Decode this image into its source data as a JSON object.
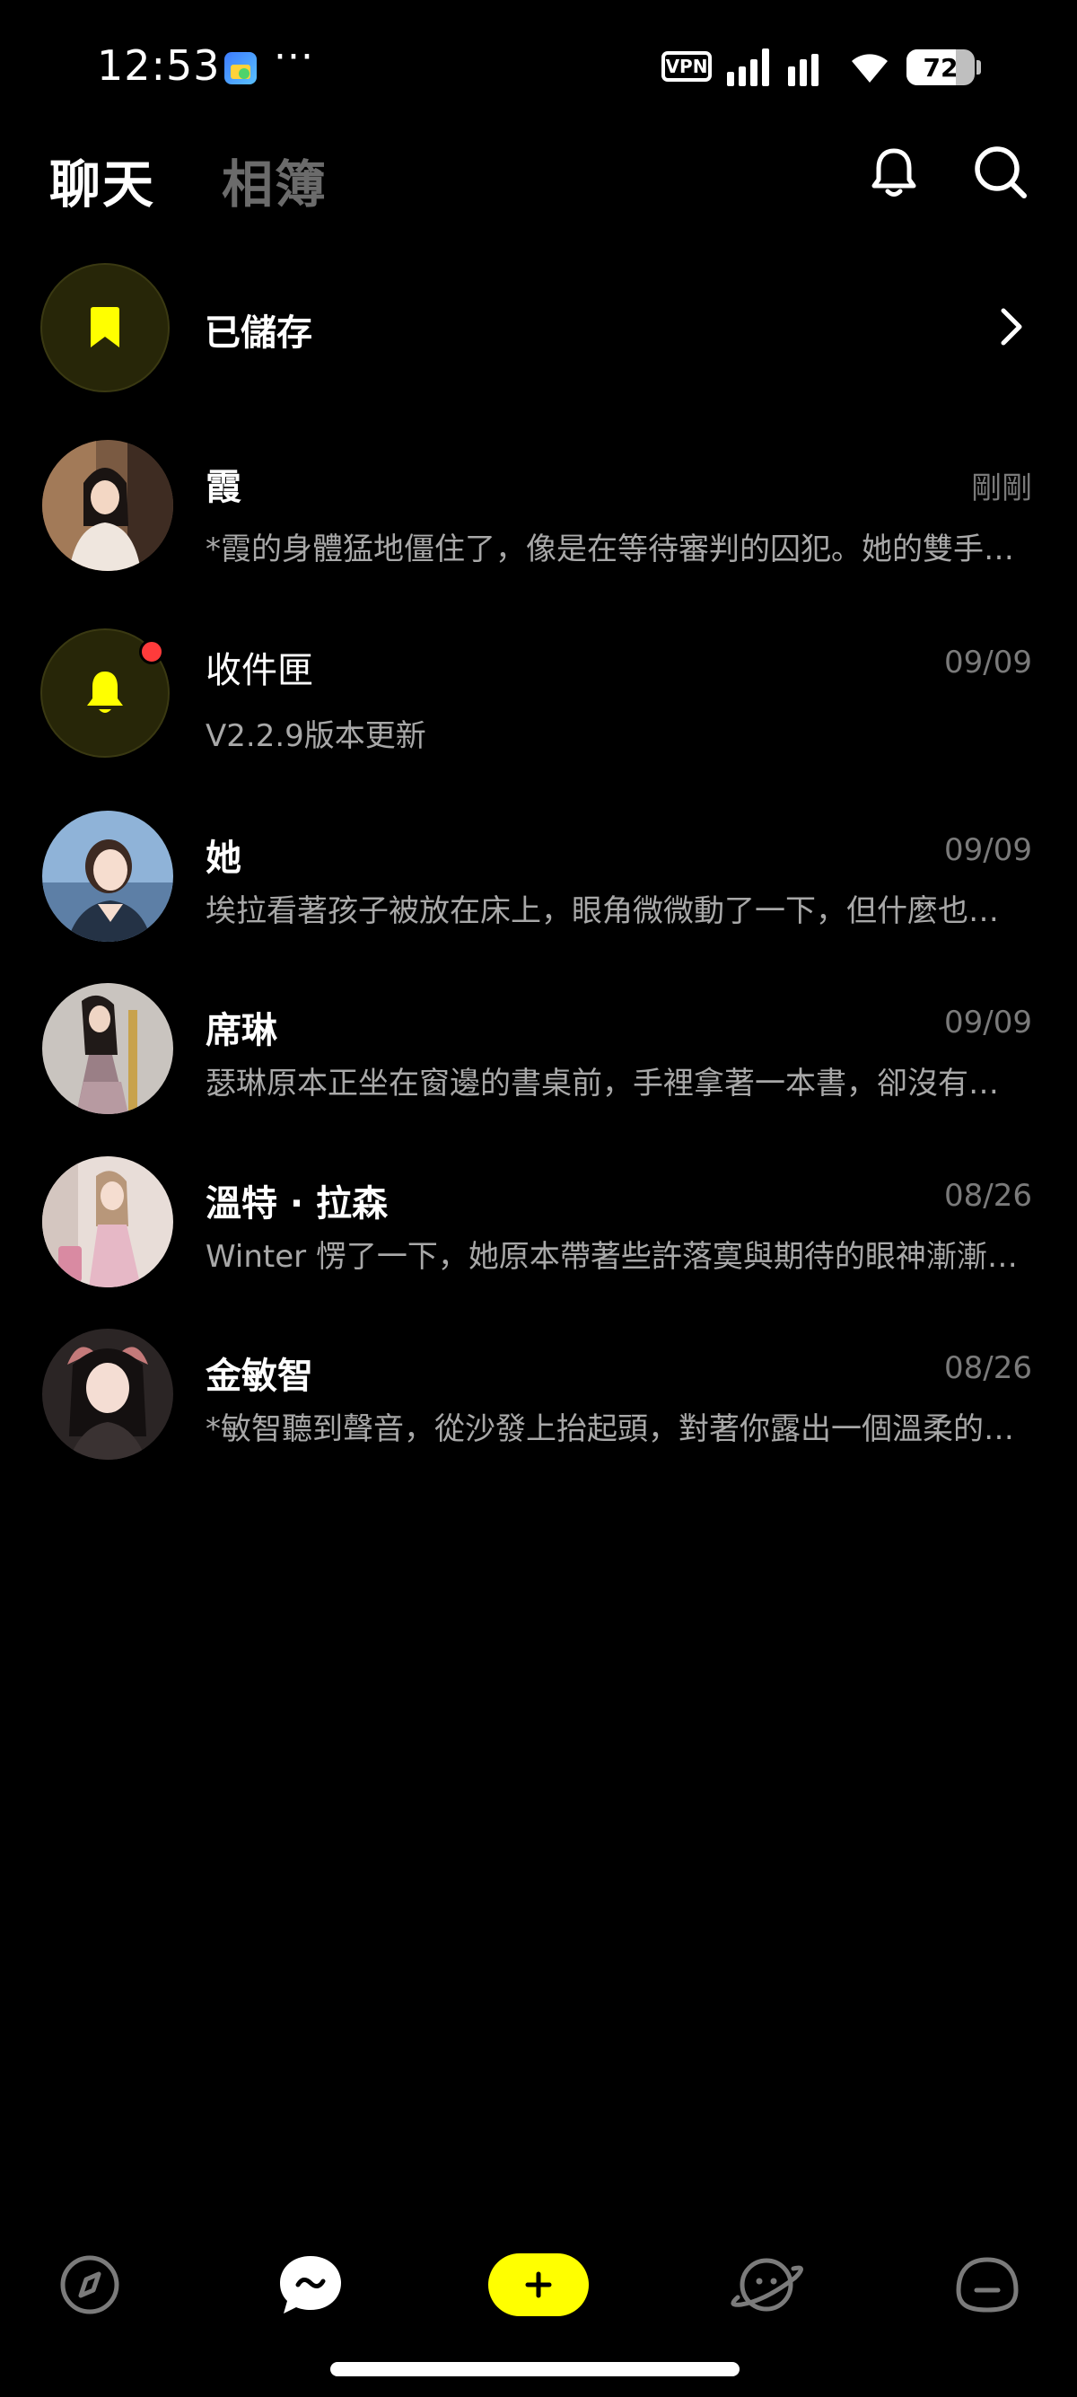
{
  "status_bar": {
    "time": "12:53",
    "more": "···",
    "vpn": "VPN",
    "battery": "72",
    "battery_level": 0.72
  },
  "header": {
    "tabs": [
      {
        "label": "聊天",
        "active": true
      },
      {
        "label": "相簿",
        "active": false
      }
    ],
    "icons": [
      "bell-icon",
      "search-icon"
    ]
  },
  "saved": {
    "label": "已儲存",
    "icon": "bookmark-icon"
  },
  "chats": [
    {
      "name": "霞",
      "time": "剛剛",
      "preview": "*霞的身體猛地僵住了，像是在等待審判的囚犯。她的雙手緊緊抓住衣角"
    },
    {
      "name": "收件匣",
      "time": "09/09",
      "preview": "V2.2.9版本更新",
      "unread": true
    },
    {
      "name": "她",
      "time": "09/09",
      "preview": "埃拉看著孩子被放在床上，眼角微微動了一下，但什麼也沒有說"
    },
    {
      "name": "席琳",
      "time": "09/09",
      "preview": "瑟琳原本正坐在窗邊的書桌前，手裡拿著一本書，卻沒有翻頁"
    },
    {
      "name": "溫特 · 拉森",
      "time": "08/26",
      "preview": "Winter 愣了一下，她原本帶著些許落寞與期待的眼神漸漸亮了起來"
    },
    {
      "name": "金敏智",
      "time": "08/26",
      "preview": "*敏智聽到聲音，從沙發上抬起頭，對著你露出一個溫柔的笑容"
    }
  ],
  "bottom_nav": {
    "items": [
      "compass-icon",
      "chat-bubble-icon",
      "add-icon",
      "planet-face-icon",
      "profile-face-icon"
    ],
    "active": "chat-bubble-icon"
  },
  "colors": {
    "background": "#000000",
    "accent": "#ffff00",
    "muted_text": "#a8a8a8",
    "time_text": "#7a7a7a",
    "unread_dot": "#ff3b3b"
  }
}
